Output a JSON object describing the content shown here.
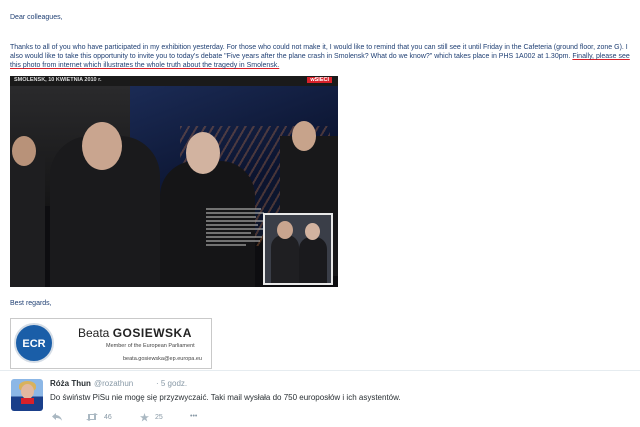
{
  "email": {
    "greeting": "Dear colleagues,",
    "paragraph_part1": "Thanks to all of you who have participated in my exhibition yesterday. For those who could not make it, I would like to remind that you can still see it until Friday in the Cafeteria (ground floor, zone G). I also would like to take this opportunity to invite you to today's debate \"Five years after the plane crash in Smolensk? What do we know?\" which takes place in PHS 1A002  at 1.30pm. ",
    "paragraph_link": "Finally, please  see this photo from internet which illustrates the whole truth about the tragedy in Smolensk.",
    "photo_header": "SMOLENSK, 10 KWIETNIA 2010 r.",
    "photo_logo": "wSIECI",
    "closing": "Best regards,",
    "signature": {
      "logo_text": "ECR",
      "first_name": "Beata",
      "last_name": "GOSIEWSKA",
      "title": "Member of the European Parliament",
      "email": "beata.gosiewska@ep.europa.eu"
    }
  },
  "tweet": {
    "name": "Róża Thun",
    "handle": "@rozathun",
    "time": "· 5 godz.",
    "text": "Do świństw PiSu nie mogę się przyzwyczaić. Taki mail wysłała do 750 europosłów i ich asystentów.",
    "actions": {
      "reply_icon": "reply-icon",
      "retweet_icon": "retweet-icon",
      "retweet_count": "46",
      "favorite_icon": "star-icon",
      "favorite_count": "25",
      "more_icon": "more-icon",
      "more": "•••"
    }
  },
  "colors": {
    "email_text": "#1f3f73",
    "underline": "#d8212a",
    "ecr_blue": "#1a5ea8",
    "tweet_gray": "#8899a6"
  }
}
